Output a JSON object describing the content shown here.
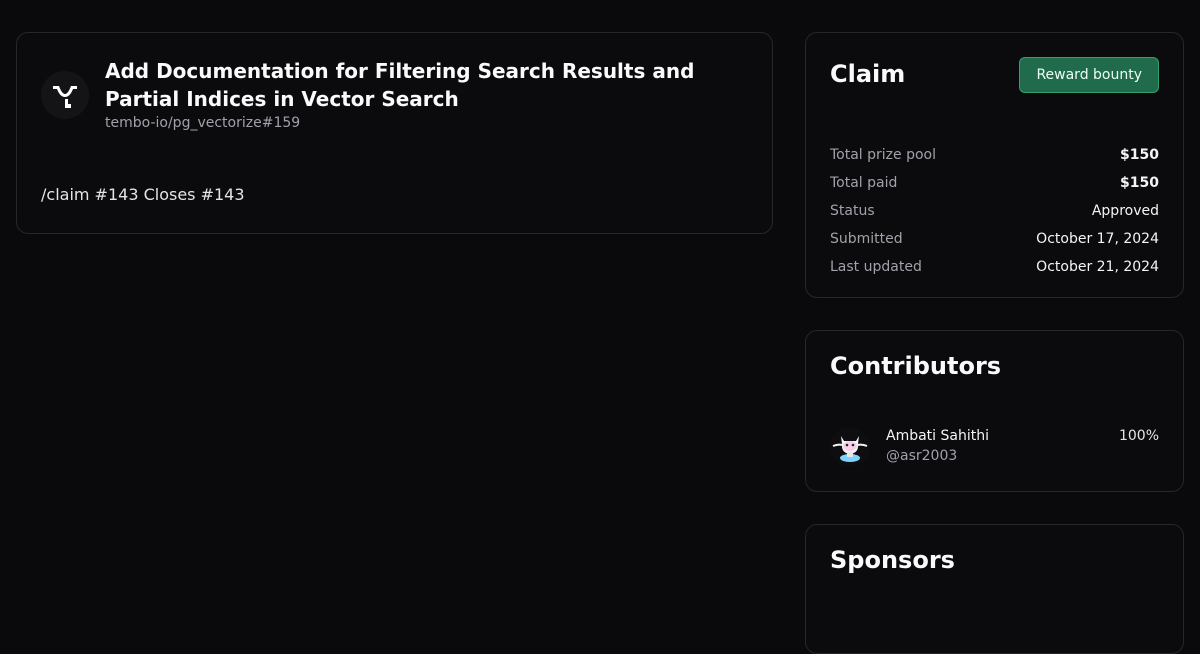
{
  "issue": {
    "title": "Add Documentation for Filtering Search Results and Partial Indices in Vector Search",
    "repo": "tembo-io/pg_vectorize#159",
    "body": "/claim #143 Closes #143",
    "org_logo_icon": "tembo-logo-icon"
  },
  "claim": {
    "title": "Claim",
    "reward_button": "Reward bounty",
    "rows": [
      {
        "label": "Total prize pool",
        "value": "$150"
      },
      {
        "label": "Total paid",
        "value": "$150"
      },
      {
        "label": "Status",
        "value": "Approved"
      },
      {
        "label": "Submitted",
        "value": "October 17, 2024"
      },
      {
        "label": "Last updated",
        "value": "October 21, 2024"
      }
    ]
  },
  "contributors": {
    "title": "Contributors",
    "items": [
      {
        "name": "Ambati Sahithi",
        "handle": "@asr2003",
        "share": "100%",
        "avatar_icon": "octocat-avatar-icon"
      }
    ]
  },
  "sponsors": {
    "title": "Sponsors"
  },
  "colors": {
    "background": "#0a0a0c",
    "card_border": "#27272a",
    "accent_green": "#1f6b4c",
    "accent_green_border": "#34a06f",
    "muted_text": "#a1a1aa"
  }
}
